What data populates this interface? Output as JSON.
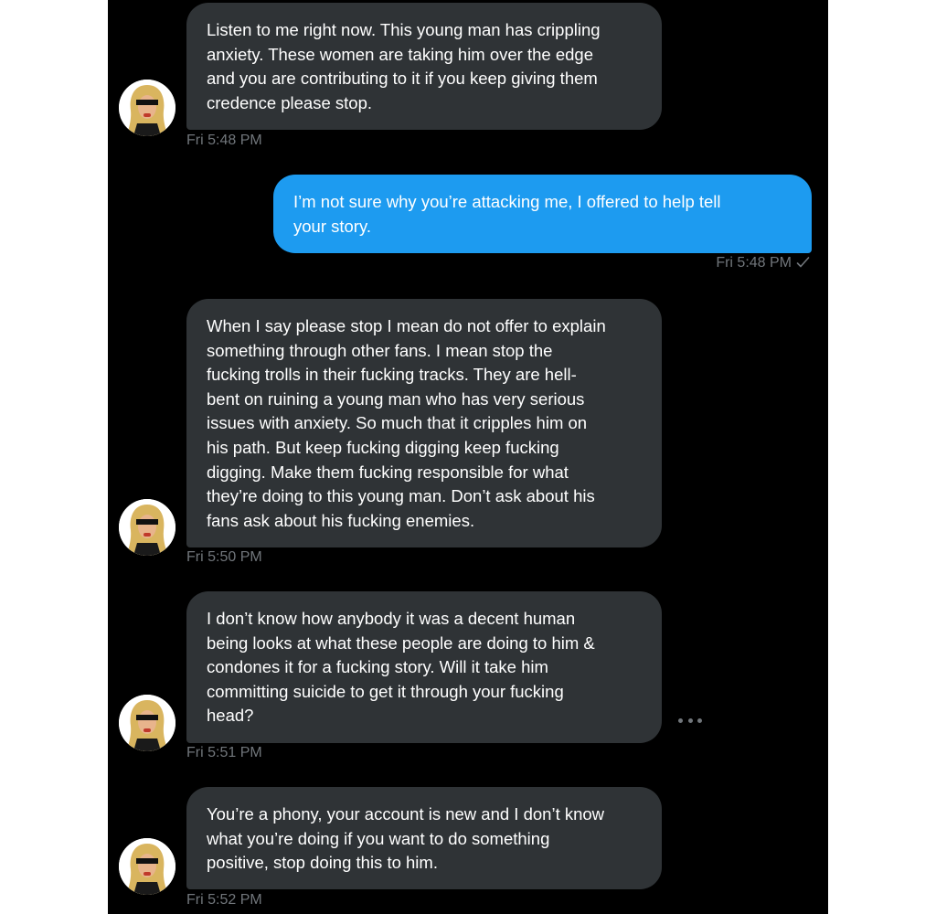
{
  "messages": [
    {
      "direction": "incoming",
      "lines": [
        "Listen to me right now. This young man has crippling",
        "anxiety. These women are taking him over the edge",
        "and you are contributing to it if you keep giving them",
        "credence please stop."
      ],
      "time": "Fri 5:48 PM"
    },
    {
      "direction": "outgoing",
      "lines": [
        "I’m not sure why you’re attacking me, I offered to help tell",
        "your story."
      ],
      "time": "Fri 5:48 PM",
      "status_icon": "check-icon"
    },
    {
      "direction": "incoming",
      "lines": [
        "When I say please stop I mean do not offer to explain",
        "something through other fans. I mean stop the",
        "fucking trolls in their fucking tracks. They are hell-",
        "bent on ruining a young man who has very serious",
        "issues with anxiety. So much that it cripples him on",
        "his path. But keep fucking digging keep fucking",
        "digging. Make them fucking responsible for what",
        "they’re doing to this young man. Don’t ask about his",
        "fans ask about his fucking enemies."
      ],
      "time": "Fri 5:50 PM"
    },
    {
      "direction": "incoming",
      "lines": [
        "I don’t know how anybody it was a decent human",
        "being looks at what these people are doing to him &",
        "condones it for a fucking story. Will it take him",
        "committing suicide to get it through your fucking",
        "head?"
      ],
      "time": "Fri 5:51 PM",
      "has_more_menu": true
    },
    {
      "direction": "incoming",
      "lines": [
        "You’re a phony, your account is new and I don’t know",
        "what you’re doing if you want to do something",
        "positive, stop doing this to him."
      ],
      "time": "Fri 5:52 PM"
    }
  ],
  "icons": {
    "avatar": "avatar-blonde-woman-icon",
    "more": "more-horizontal-icon",
    "sent_status": "check-icon"
  },
  "colors": {
    "background": "#000000",
    "incoming_bubble": "#2f3336",
    "outgoing_bubble": "#1d9bf0",
    "message_text": "#ffffff",
    "timestamp_text": "#71767b"
  }
}
